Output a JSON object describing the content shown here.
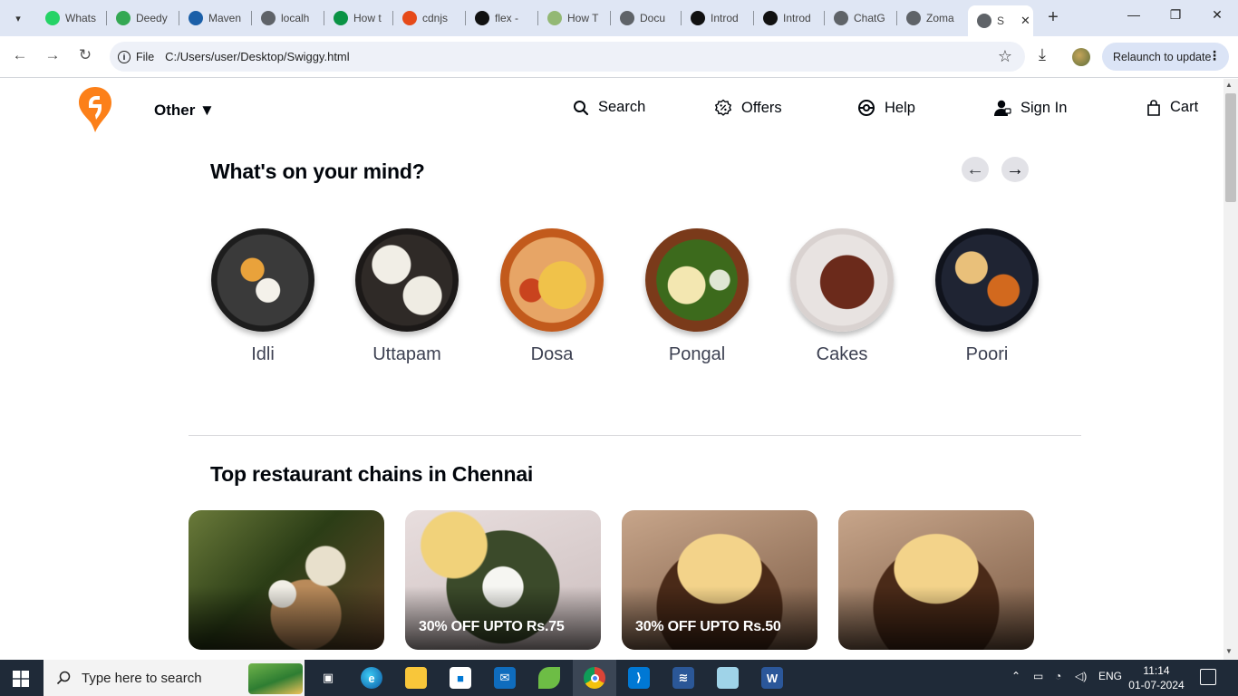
{
  "browser": {
    "tabs": [
      {
        "title": "Whats",
        "icon": "whatsapp-icon",
        "color": "#25d366"
      },
      {
        "title": "Deedy",
        "icon": "deedy-icon",
        "color": "#34a853"
      },
      {
        "title": "Maven",
        "icon": "maven-icon",
        "color": "#1b5fa8"
      },
      {
        "title": "localh",
        "icon": "globe-icon",
        "color": "#5f6368"
      },
      {
        "title": "How t",
        "icon": "freecodecamp-icon",
        "color": "#0a9345"
      },
      {
        "title": "cdnjs",
        "icon": "code-icon",
        "color": "#e64a19"
      },
      {
        "title": "flex -",
        "icon": "mdn-icon",
        "color": "#111111"
      },
      {
        "title": "How T",
        "icon": "wikihow-icon",
        "color": "#93b874"
      },
      {
        "title": "Docu",
        "icon": "globe-icon",
        "color": "#5f6368"
      },
      {
        "title": "Introd",
        "icon": "openai-icon",
        "color": "#111111"
      },
      {
        "title": "Introd",
        "icon": "openai-icon",
        "color": "#111111"
      },
      {
        "title": "ChatG",
        "icon": "chatgpt-icon",
        "color": "#5f6368"
      },
      {
        "title": "Zoma",
        "icon": "globe-icon",
        "color": "#5f6368"
      },
      {
        "title": "S",
        "icon": "globe-icon",
        "color": "#5f6368"
      }
    ],
    "address": {
      "scheme_label": "File",
      "url": "C:/Users/user/Desktop/Swiggy.html"
    },
    "relaunch_label": "Relaunch to update"
  },
  "header": {
    "location": "Other ▼",
    "nav": {
      "search": "Search",
      "offers": "Offers",
      "help": "Help",
      "signin": "Sign In",
      "cart": "Cart"
    }
  },
  "mind": {
    "title": "What's on your mind?",
    "items": [
      {
        "label": "Idli"
      },
      {
        "label": "Uttapam"
      },
      {
        "label": "Dosa"
      },
      {
        "label": "Pongal"
      },
      {
        "label": "Cakes"
      },
      {
        "label": "Poori"
      }
    ]
  },
  "chains": {
    "title": "Top restaurant chains in Chennai",
    "cards": [
      {
        "offer": ""
      },
      {
        "offer": "30% OFF UPTO Rs.75"
      },
      {
        "offer": "30% OFF UPTO Rs.50"
      },
      {
        "offer": ""
      }
    ]
  },
  "taskbar": {
    "search_placeholder": "Type here to search",
    "language": "ENG",
    "time": "11:14",
    "date": "01-07-2024"
  },
  "colors": {
    "brand": "#fc8019",
    "text": "#02060c",
    "muted": "#3d4152"
  }
}
